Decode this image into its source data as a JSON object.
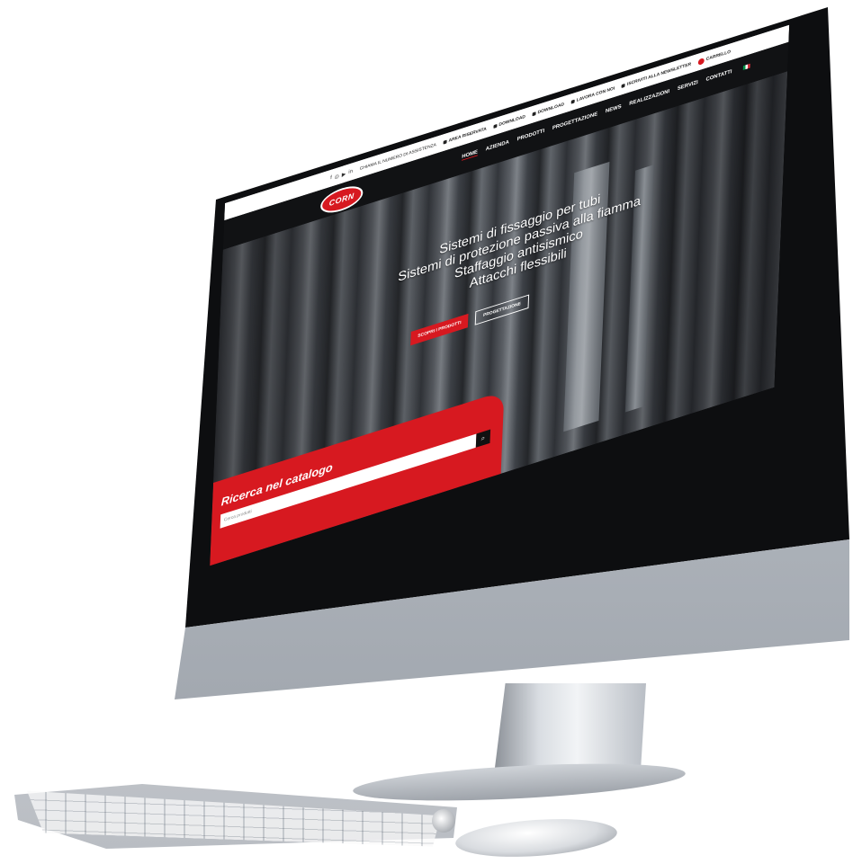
{
  "topbar": {
    "social": [
      "f",
      "◎",
      "▶",
      "in"
    ],
    "links": [
      "CHIAMA IL NUMERO DI ASSISTENZA",
      "AREA RISERVATA",
      "DOWNLOAD",
      "DOWNLOAD",
      "LAVORA CON NOI",
      "ISCRIVITI ALLA NEWSLETTER"
    ],
    "cart_label": "CARRELLO"
  },
  "nav": {
    "logo": "CORN",
    "items": [
      "HOME",
      "AZIENDA",
      "PRODOTTI",
      "PROGETTAZIONE",
      "NEWS",
      "REALIZZAZIONI",
      "SERVIZI",
      "CONTATTI"
    ]
  },
  "hero": {
    "lines": [
      "Sistemi di fissaggio per tubi",
      "Sistemi di protezione passiva alla fiamma",
      "Staffaggio antisismico",
      "Attacchi flessibili"
    ],
    "primary_button": "SCOPRI I PRODOTTI",
    "secondary_button": "PROGETTAZIONE"
  },
  "search": {
    "title": "Ricerca nel catalogo",
    "placeholder": "Cerca prodotti"
  },
  "colors": {
    "brand_red": "#d71920",
    "nav_bg": "#111214"
  }
}
